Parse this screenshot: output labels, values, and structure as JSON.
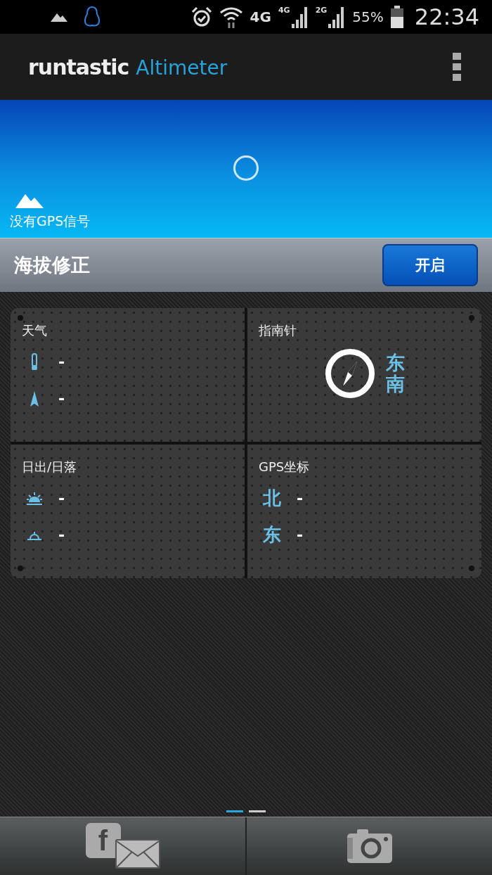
{
  "status_bar": {
    "network": "4G",
    "sim1": "4G",
    "sim2": "2G",
    "battery": "55%",
    "time": "22:34"
  },
  "app_bar": {
    "logo": "runtastic",
    "product": "Altimeter"
  },
  "hero": {
    "gps_status": "没有GPS信号"
  },
  "correction": {
    "label": "海拔修正",
    "button": "开启"
  },
  "panels": [
    {
      "kind": "rows",
      "title": "天气",
      "rows": [
        {
          "kind": "temperature",
          "value": "-"
        },
        {
          "kind": "wind",
          "value": "-"
        }
      ]
    },
    {
      "kind": "compass",
      "title": "指南针",
      "direction": "东南"
    },
    {
      "kind": "rows",
      "title": "日出/日落",
      "rows": [
        {
          "kind": "sunrise",
          "value": "-"
        },
        {
          "kind": "sunset",
          "value": "-"
        }
      ]
    },
    {
      "kind": "rows",
      "title": "GPS坐标",
      "rows": [
        {
          "label": "北",
          "value": "-"
        },
        {
          "label": "东",
          "value": "-"
        }
      ]
    }
  ],
  "pager": [
    {
      "selected": true
    },
    {
      "selected": false
    }
  ],
  "bottom_bar": {
    "share_glyph": "f"
  }
}
